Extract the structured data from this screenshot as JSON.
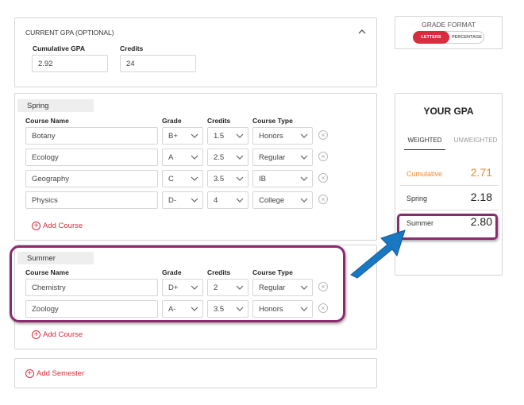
{
  "current_gpa": {
    "header": "CURRENT GPA (OPTIONAL)",
    "cumulative_label": "Cumulative GPA",
    "cumulative_value": "2.92",
    "credits_label": "Credits",
    "credits_value": "24"
  },
  "columns": {
    "course_name": "Course Name",
    "grade": "Grade",
    "credits": "Credits",
    "course_type": "Course Type"
  },
  "semesters": [
    {
      "name": "Spring",
      "courses": [
        {
          "name": "Botany",
          "grade": "B+",
          "credits": "1.5",
          "type": "Honors"
        },
        {
          "name": "Ecology",
          "grade": "A",
          "credits": "2.5",
          "type": "Regular"
        },
        {
          "name": "Geography",
          "grade": "C",
          "credits": "3.5",
          "type": "IB"
        },
        {
          "name": "Physics",
          "grade": "D-",
          "credits": "4",
          "type": "College"
        }
      ],
      "add_course": "Add Course"
    },
    {
      "name": "Summer",
      "courses": [
        {
          "name": "Chemistry",
          "grade": "D+",
          "credits": "2",
          "type": "Regular"
        },
        {
          "name": "Zoology",
          "grade": "A-",
          "credits": "3.5",
          "type": "Honors"
        }
      ],
      "add_course": "Add Course"
    }
  ],
  "add_semester": "Add Semester",
  "grade_format": {
    "title": "GRADE FORMAT",
    "letters": "LETTERS",
    "percentage": "PERCENTAGE"
  },
  "your_gpa": {
    "title": "YOUR GPA",
    "tab_weighted": "WEIGHTED",
    "tab_unweighted": "UNWEIGHTED",
    "rows": [
      {
        "label": "Cumulative",
        "value": "2.71"
      },
      {
        "label": "Spring",
        "value": "2.18"
      },
      {
        "label": "Summer",
        "value": "2.80"
      }
    ]
  },
  "colors": {
    "accent": "#d72d3e",
    "orange": "#f28b30",
    "highlight": "#8b2a6e",
    "arrow": "#1a78c2"
  }
}
